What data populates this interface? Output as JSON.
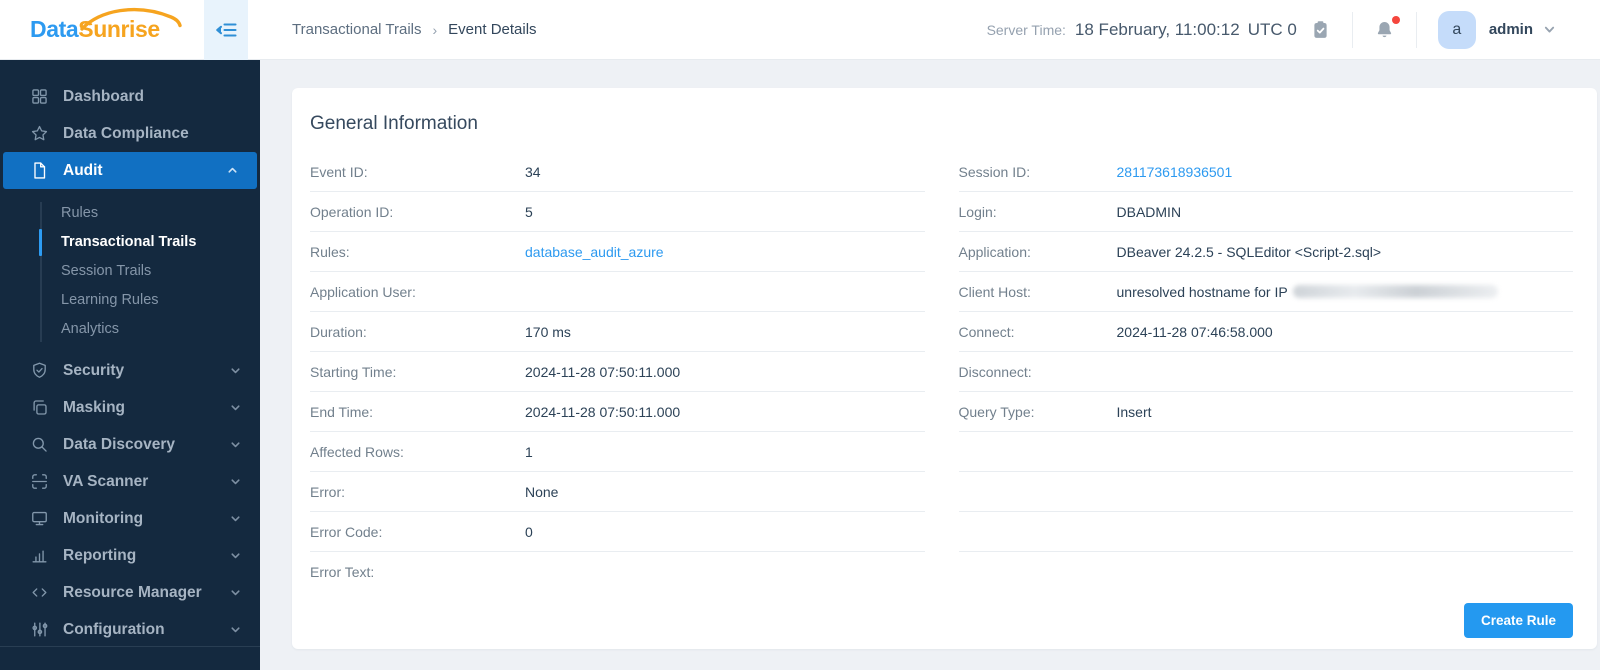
{
  "brand": {
    "name_part1": "Data",
    "name_part2": "Sunrise",
    "logo_blue": "#2d9af0",
    "logo_orange": "#f6a41f"
  },
  "header": {
    "fold_icon": "menu-fold-icon",
    "breadcrumb": {
      "parent": "Transactional Trails",
      "separator": "›",
      "current": "Event Details"
    },
    "server_time_label": "Server Time:",
    "server_time_value": "18 February, 11:00:12",
    "server_time_zone": "UTC 0",
    "time_icon": "clipboard-check-icon",
    "notifications_icon": "bell-icon",
    "notification_dot_color": "#f5463d",
    "user": {
      "initial": "a",
      "name": "admin",
      "caret_icon": "chevron-down-icon"
    }
  },
  "sidebar": {
    "bg_color": "#14293f",
    "active_item_color": "#1170c2",
    "active_subitem_accent": "#2d9cf3",
    "items": [
      {
        "label": "Dashboard",
        "icon": "grid"
      },
      {
        "label": "Data Compliance",
        "icon": "star"
      },
      {
        "label": "Audit",
        "icon": "document",
        "active": true,
        "chevron": "up",
        "children": [
          {
            "label": "Rules"
          },
          {
            "label": "Transactional Trails",
            "active": true
          },
          {
            "label": "Session Trails"
          },
          {
            "label": "Learning Rules"
          },
          {
            "label": "Analytics"
          }
        ]
      },
      {
        "label": "Security",
        "icon": "shield-check",
        "chevron": "down"
      },
      {
        "label": "Masking",
        "icon": "copy",
        "chevron": "down"
      },
      {
        "label": "Data Discovery",
        "icon": "search",
        "chevron": "down"
      },
      {
        "label": "VA Scanner",
        "icon": "scan",
        "chevron": "down"
      },
      {
        "label": "Monitoring",
        "icon": "monitor",
        "chevron": "down"
      },
      {
        "label": "Reporting",
        "icon": "bar-chart",
        "chevron": "down"
      },
      {
        "label": "Resource Manager",
        "icon": "code",
        "chevron": "down"
      },
      {
        "label": "Configuration",
        "icon": "sliders",
        "chevron": "down"
      }
    ]
  },
  "main": {
    "title": "General Information",
    "left_rows": [
      {
        "label": "Event ID:",
        "value": "34"
      },
      {
        "label": "Operation ID:",
        "value": "5"
      },
      {
        "label": "Rules:",
        "value": "database_audit_azure",
        "link": true
      },
      {
        "label": "Application User:",
        "value": ""
      },
      {
        "label": "Duration:",
        "value": "170 ms"
      },
      {
        "label": "Starting Time:",
        "value": "2024-11-28 07:50:11.000"
      },
      {
        "label": "End Time:",
        "value": "2024-11-28 07:50:11.000"
      },
      {
        "label": "Affected Rows:",
        "value": "1"
      },
      {
        "label": "Error:",
        "value": "None"
      },
      {
        "label": "Error Code:",
        "value": "0"
      },
      {
        "label": "Error Text:",
        "value": ""
      }
    ],
    "right_rows": [
      {
        "label": "Session ID:",
        "value": "281173618936501",
        "link": true
      },
      {
        "label": "Login:",
        "value": "DBADMIN"
      },
      {
        "label": "Application:",
        "value": "DBeaver 24.2.5 - SQLEditor <Script-2.sql>"
      },
      {
        "label": "Client Host:",
        "value": "unresolved hostname for IP",
        "redacted": true
      },
      {
        "label": "Connect:",
        "value": "2024-11-28 07:46:58.000"
      },
      {
        "label": "Disconnect:",
        "value": ""
      },
      {
        "label": "Query Type:",
        "value": "Insert"
      },
      {
        "label": "",
        "value": ""
      },
      {
        "label": "",
        "value": ""
      },
      {
        "label": "",
        "value": ""
      },
      {
        "label": "",
        "value": ""
      }
    ],
    "create_rule_label": "Create Rule"
  },
  "colors": {
    "accent_blue": "#2d9af0",
    "button_blue": "#2499f0",
    "link_blue": "#2d9af0",
    "sidebar_bg": "#14293f",
    "active_nav_bg": "#1170c2",
    "page_bg": "#eef1f5",
    "text_dark": "#2c4257",
    "label_gray": "#72808d"
  }
}
